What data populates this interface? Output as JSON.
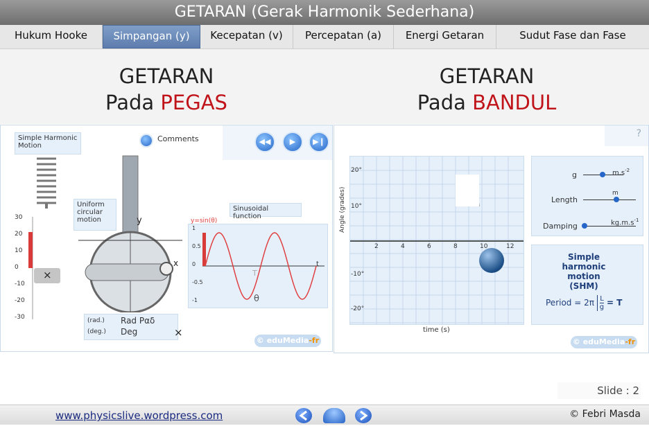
{
  "title": "GETARAN (Gerak Harmonik Sederhana)",
  "tabs": [
    {
      "label": "Hukum Hooke"
    },
    {
      "label": "Simpangan (y)",
      "active": true
    },
    {
      "label": "Kecepatan (v)"
    },
    {
      "label": "Percepatan (a)"
    },
    {
      "label": "Energi Getaran"
    },
    {
      "label": "Sudut Fase dan Fase"
    }
  ],
  "left": {
    "heading_line1": "GETARAN",
    "heading_pre": "Pada ",
    "heading_red": "PEGAS",
    "sim": {
      "label_shm": "Simple Harmonic Motion",
      "comments": "Comments",
      "uniform": "Uniform circular motion",
      "sinusoidal": "Sinusoidal function",
      "y_eq": "y=sin(θ)",
      "ruler_ticks": [
        "30",
        "20",
        "10",
        "0",
        "-10",
        "-20",
        "-30"
      ],
      "sine_ticks": [
        "1",
        "0.5",
        "0",
        "-0.5",
        "-1"
      ],
      "axis_y": "y",
      "axis_x": "x",
      "axis_t": "t",
      "theta": "θ",
      "T_label": "T",
      "rad_label": "(rad.)",
      "deg_label": "(deg.)",
      "rad_opt": "Rad Pαδ",
      "deg_opt": "Deg",
      "close": "×",
      "edu": "© eduMedia",
      "edu_fr": "-fr"
    }
  },
  "right": {
    "heading_line1": "GETARAN",
    "heading_pre": "Pada ",
    "heading_red": "BANDUL",
    "sim": {
      "help": "?",
      "y_axis_label": "Angle (grades)",
      "x_axis_label": "time (s)",
      "y_ticks": [
        "20°",
        "10°",
        "-10°",
        "-20°"
      ],
      "x_ticks": [
        "2",
        "4",
        "6",
        "8",
        "10",
        "12"
      ],
      "g_label": "g",
      "g_unit": "m.s",
      "g_exp": "-2",
      "length_label": "Length",
      "length_unit": "m",
      "damping_label": "Damping",
      "damping_unit": "kg.m.s",
      "damping_exp": "-1",
      "shm_title": "Simple harmonic motion (SHM)",
      "period_pre": "Period = 2π",
      "period_num": "L",
      "period_den": "g",
      "period_post": "= T",
      "edu": "© eduMedia",
      "edu_fr": "-fr"
    }
  },
  "slide_number": "Slide : 2",
  "footer": {
    "url": "www.physicslive.wordpress.com",
    "copyright": "© Febri Masda",
    "prev_icon": "arrow-left-icon",
    "home_icon": "home-icon",
    "next_icon": "arrow-right-icon"
  },
  "colors": {
    "accent_red": "#c0141a",
    "active_tab": "#5d7cae",
    "sim_blue": "#2566c8",
    "sine_red": "#e04040"
  }
}
